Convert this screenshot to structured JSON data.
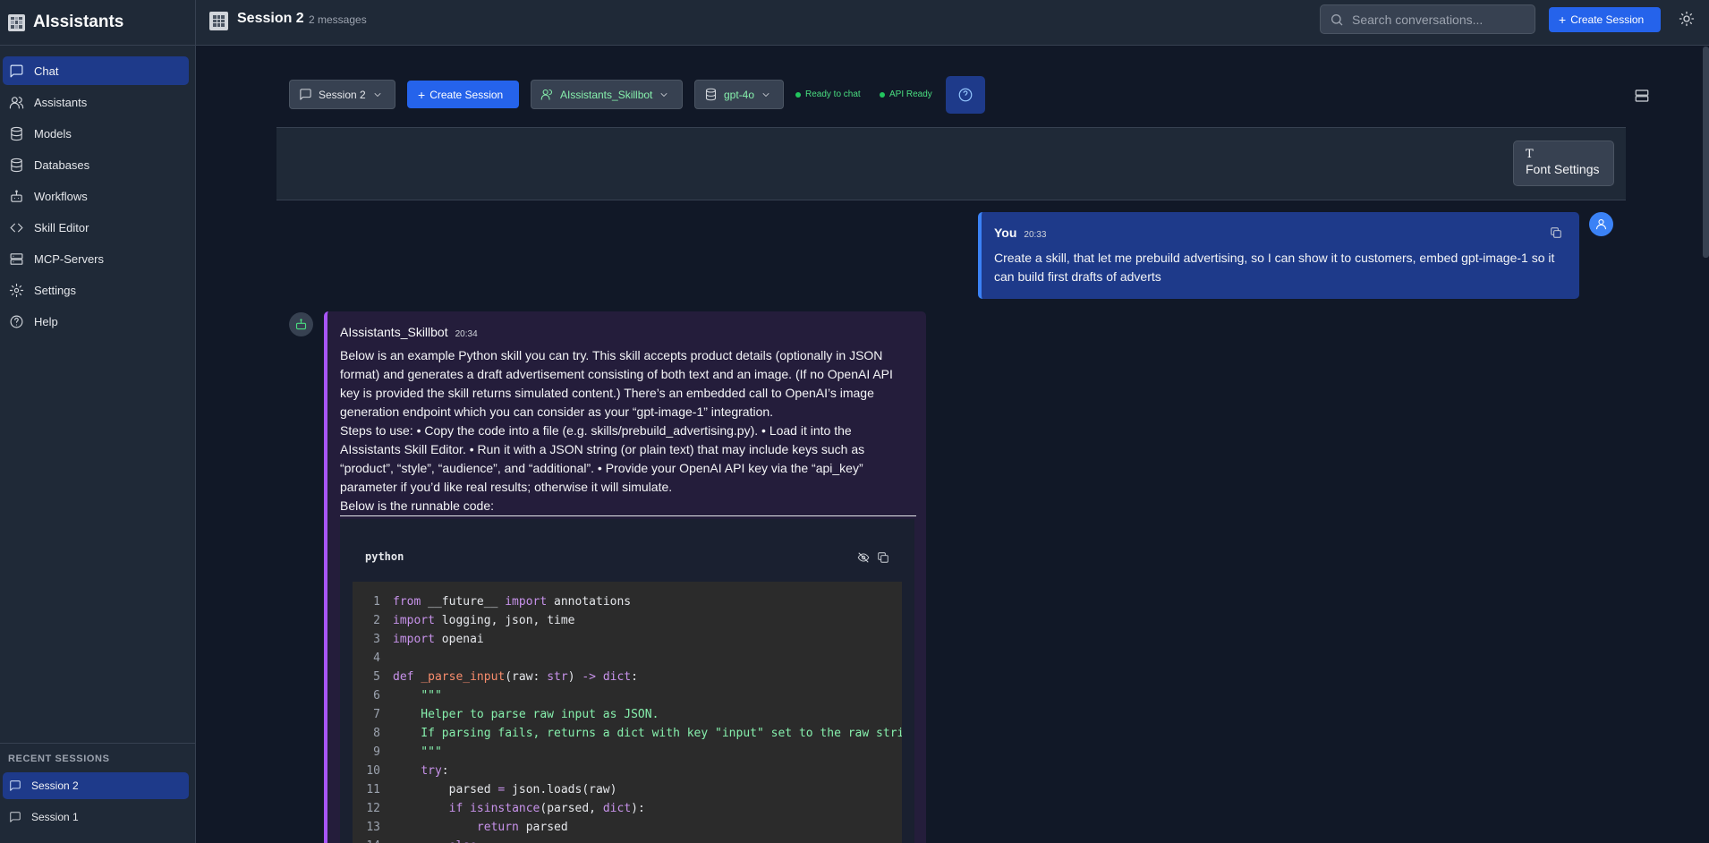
{
  "app": {
    "title": "AIssistants"
  },
  "sidebar": {
    "items": [
      {
        "label": "Chat",
        "icon": "chat-icon",
        "active": true
      },
      {
        "label": "Assistants",
        "icon": "users-icon",
        "active": false
      },
      {
        "label": "Models",
        "icon": "database-icon",
        "active": false
      },
      {
        "label": "Databases",
        "icon": "database-icon",
        "active": false
      },
      {
        "label": "Workflows",
        "icon": "bot-icon",
        "active": false
      },
      {
        "label": "Skill Editor",
        "icon": "code-icon",
        "active": false
      },
      {
        "label": "MCP-Servers",
        "icon": "server-icon",
        "active": false
      },
      {
        "label": "Settings",
        "icon": "gear-icon",
        "active": false
      },
      {
        "label": "Help",
        "icon": "help-icon",
        "active": false
      }
    ],
    "recent_title": "RECENT SESSIONS",
    "recent": [
      {
        "label": "Session 2",
        "active": true
      },
      {
        "label": "Session 1",
        "active": false
      }
    ]
  },
  "header": {
    "title": "Session 2",
    "count": "2 messages",
    "search_placeholder": "Search conversations...",
    "create_label": "Create Session"
  },
  "toolbar": {
    "session_label": "Session 2",
    "create_label": "Create Session",
    "assistant_label": "AIssistants_Skillbot",
    "model_label": "gpt-4o",
    "status_ready": "Ready to chat",
    "status_api": "API Ready"
  },
  "font_settings": {
    "glyph": "T",
    "label": "Font Settings"
  },
  "messages": {
    "user": {
      "author": "You",
      "time": "20:33",
      "body": "Create a skill, that let me prebuild advertising, so I can show it to customers, embed gpt-image-1 so it can build first drafts of adverts"
    },
    "bot": {
      "author": "AIssistants_Skillbot",
      "time": "20:34",
      "para1": "Below is an example Python skill you can try. This skill accepts product details (optionally in JSON format) and generates a draft advertisement consisting of both text and an image. (If no OpenAI API key is provided the skill returns simulated content.) There’s an embedded call to OpenAI’s image generation endpoint which you can consider as your “gpt-image-1” integration.",
      "para2": "Steps to use: • Copy the code into a file (e.g. skills/prebuild_advertising.py). • Load it into the AIssistants Skill Editor. • Run it with a JSON string (or plain text) that may include keys such as “product”, “style”, “audience”, and “additional”. • Provide your OpenAI API key via the “api_key” parameter if you’d like real results; otherwise it will simulate.",
      "para3": "Below is the runnable code:",
      "code_lang": "python",
      "code_lines": [
        {
          "n": "1",
          "html": "<span class=\"kw\">from</span> __future__ <span class=\"kw\">import</span> annotations"
        },
        {
          "n": "2",
          "html": "<span class=\"kw\">import</span> logging, json, time"
        },
        {
          "n": "3",
          "html": "<span class=\"kw\">import</span> openai"
        },
        {
          "n": "4",
          "html": ""
        },
        {
          "n": "5",
          "html": "<span class=\"kw\">def</span> <span class=\"fn\">_parse_input</span>(raw: <span class=\"kw\">str</span>) <span class=\"op\">-&gt;</span> <span class=\"kw\">dict</span>:"
        },
        {
          "n": "6",
          "html": "    <span class=\"str\">\"\"\"</span>"
        },
        {
          "n": "7",
          "html": "<span class=\"str\">    Helper to parse raw input as JSON.</span>"
        },
        {
          "n": "8",
          "html": "<span class=\"str\">    If parsing fails, returns a dict with key \"input\" set to the raw string.</span>"
        },
        {
          "n": "9",
          "html": "<span class=\"str\">    \"\"\"</span>"
        },
        {
          "n": "10",
          "html": "    <span class=\"kw\">try</span>:"
        },
        {
          "n": "11",
          "html": "        parsed <span class=\"op\">=</span> json.loads(raw)"
        },
        {
          "n": "12",
          "html": "        <span class=\"kw\">if</span> <span class=\"kw\">isinstance</span>(parsed, <span class=\"kw\">dict</span>):"
        },
        {
          "n": "13",
          "html": "            <span class=\"kw\">return</span> parsed"
        },
        {
          "n": "14",
          "html": "        <span class=\"kw\">else</span>:"
        }
      ]
    }
  },
  "colors": {
    "background": "#111827",
    "sidebar": "#1f2937",
    "accent": "#2563eb",
    "active_nav": "#1e3a8a",
    "user_bubble": "#1e3a8a",
    "bot_bubble": "#241d3b",
    "bot_accent": "#a855f7",
    "status_green": "#22c55e"
  }
}
